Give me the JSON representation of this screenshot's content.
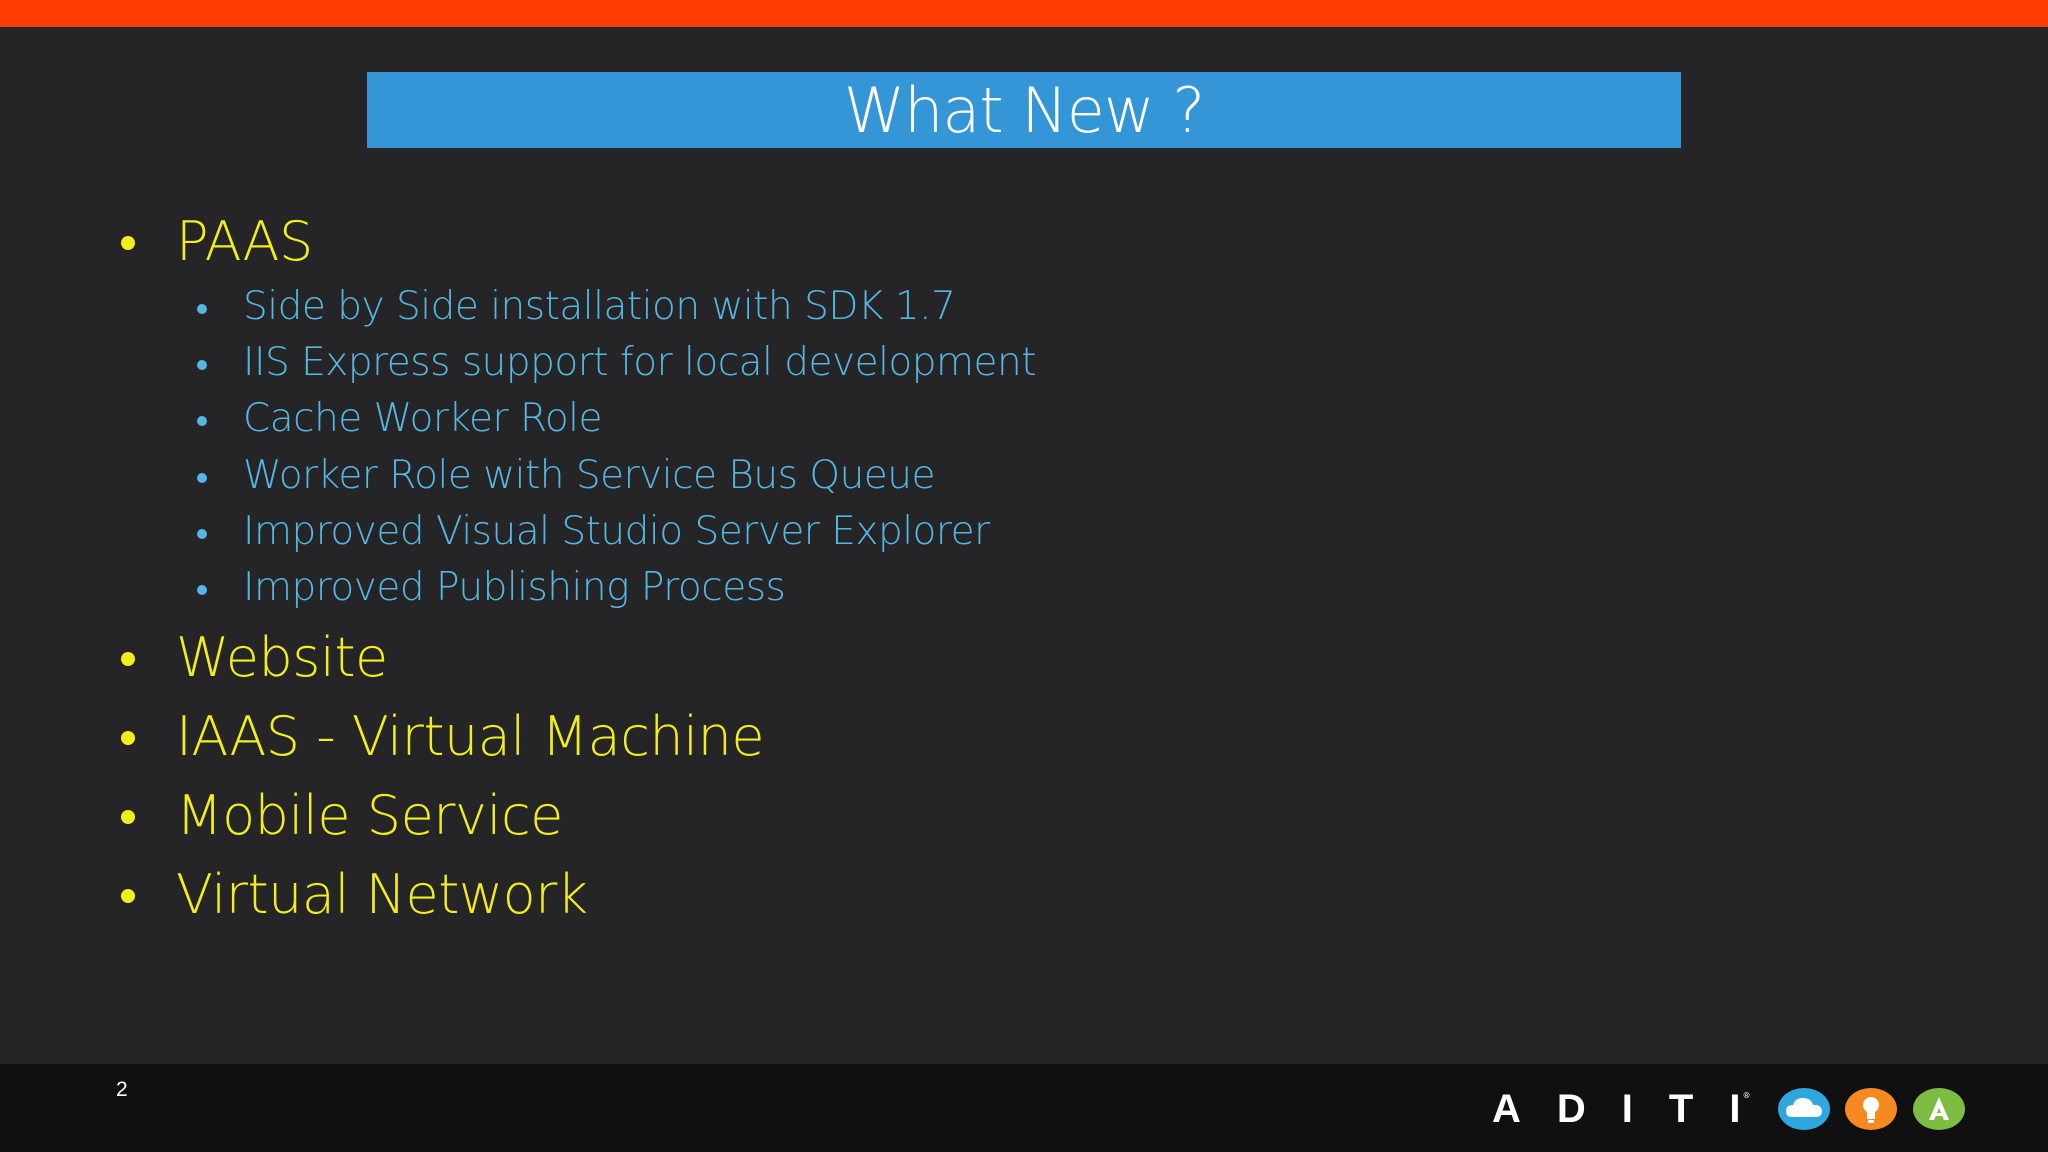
{
  "slide": {
    "title": "What New ?",
    "page_number": "2"
  },
  "bullets": [
    {
      "label": "PAAS",
      "children": [
        "Side by Side installation with SDK 1.7",
        "IIS Express support for local development",
        "Cache Worker Role",
        "Worker Role with Service Bus Queue",
        "Improved Visual Studio Server Explorer",
        "Improved Publishing Process"
      ]
    },
    {
      "label": "Website"
    },
    {
      "label": "IAAS - Virtual Machine"
    },
    {
      "label": "Mobile Service"
    },
    {
      "label": "Virtual Network"
    }
  ],
  "footer": {
    "logo_text": "ADITI",
    "logo_registered": "®",
    "logo_icons": [
      "cloud-icon",
      "lightbulb-icon",
      "a-letter-icon"
    ]
  },
  "colors": {
    "top_bar": "#fe3e05",
    "title_background": "#3496d6",
    "slide_background": "#252528",
    "level1_text": "#f2ee1c",
    "level2_text": "#55b8e2",
    "footer_background": "#101011",
    "cloud_icon": "#2ea6de",
    "lightbulb_icon": "#f48a20",
    "a_icon": "#7cbd42"
  }
}
